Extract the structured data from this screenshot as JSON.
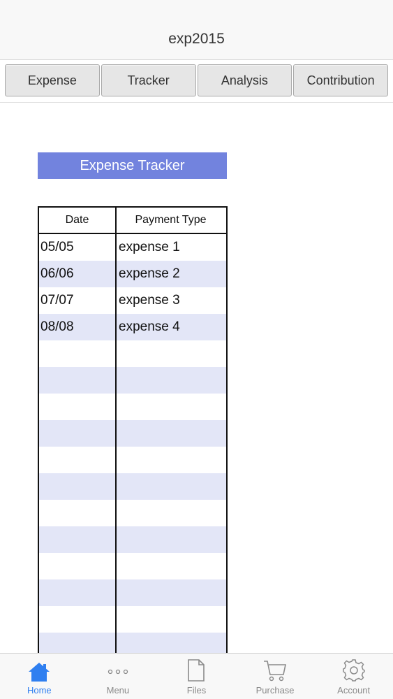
{
  "header": {
    "title": "exp2015"
  },
  "tabs": [
    {
      "label": "Expense"
    },
    {
      "label": "Tracker"
    },
    {
      "label": "Analysis"
    },
    {
      "label": "Contribution"
    }
  ],
  "banner": {
    "label": "Expense Tracker"
  },
  "table": {
    "columns": [
      "Date",
      "Payment Type"
    ],
    "rows": [
      {
        "date": "05/05",
        "type": "expense 1"
      },
      {
        "date": "06/06",
        "type": "expense 2"
      },
      {
        "date": "07/07",
        "type": "expense 3"
      },
      {
        "date": "08/08",
        "type": "expense 4"
      }
    ],
    "empty_rows": 12
  },
  "tabbar": [
    {
      "label": "Home",
      "icon": "home-icon",
      "active": true
    },
    {
      "label": "Menu",
      "icon": "more-icon",
      "active": false
    },
    {
      "label": "Files",
      "icon": "file-icon",
      "active": false
    },
    {
      "label": "Purchase",
      "icon": "cart-icon",
      "active": false
    },
    {
      "label": "Account",
      "icon": "gear-icon",
      "active": false
    }
  ],
  "colors": {
    "accent": "#2f7ff0",
    "banner": "#7283de",
    "row_alt": "#e3e6f7"
  }
}
